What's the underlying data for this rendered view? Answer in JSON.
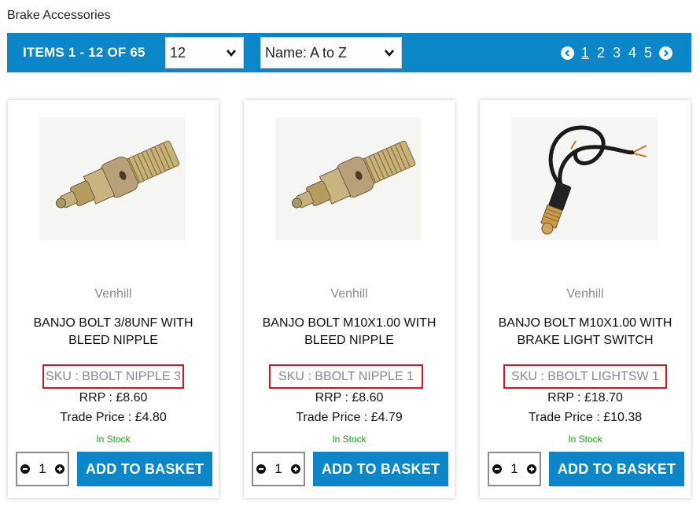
{
  "breadcrumb": "Brake Accessories",
  "toolbar": {
    "items_text": "ITEMS 1 - 12 OF 65",
    "per_page_value": "12",
    "sort_value": "Name: A to Z",
    "pages": [
      "1",
      "2",
      "3",
      "4",
      "5"
    ],
    "current_page": "1",
    "prev_icon": "chevron-left-circle-icon",
    "next_icon": "chevron-right-circle-icon"
  },
  "colors": {
    "accent": "#0a86c9",
    "sku_highlight": "#e0101a",
    "in_stock": "#1aa51a"
  },
  "products": [
    {
      "brand": "Venhill",
      "title": "BANJO BOLT 3/8UNF WITH BLEED NIPPLE",
      "sku": "SKU : BBOLT NIPPLE 3",
      "rrp": "RRP : £8.60",
      "trade": "Trade Price : £4.80",
      "stock": "In Stock",
      "qty": "1",
      "add_label": "ADD TO BASKET",
      "image": "banjo-bolt-bleed-nipple"
    },
    {
      "brand": "Venhill",
      "title": "BANJO BOLT M10X1.00 WITH BLEED NIPPLE",
      "sku": "SKU : BBOLT NIPPLE 1",
      "rrp": "RRP : £8.60",
      "trade": "Trade Price : £4.79",
      "stock": "In Stock",
      "qty": "1",
      "add_label": "ADD TO BASKET",
      "image": "banjo-bolt-bleed-nipple"
    },
    {
      "brand": "Venhill",
      "title": "BANJO BOLT M10X1.00 WITH BRAKE LIGHT SWITCH",
      "sku": "SKU : BBOLT LIGHTSW 1",
      "rrp": "RRP : £18.70",
      "trade": "Trade Price : £10.38",
      "stock": "In Stock",
      "qty": "1",
      "add_label": "ADD TO BASKET",
      "image": "banjo-bolt-light-switch"
    }
  ]
}
